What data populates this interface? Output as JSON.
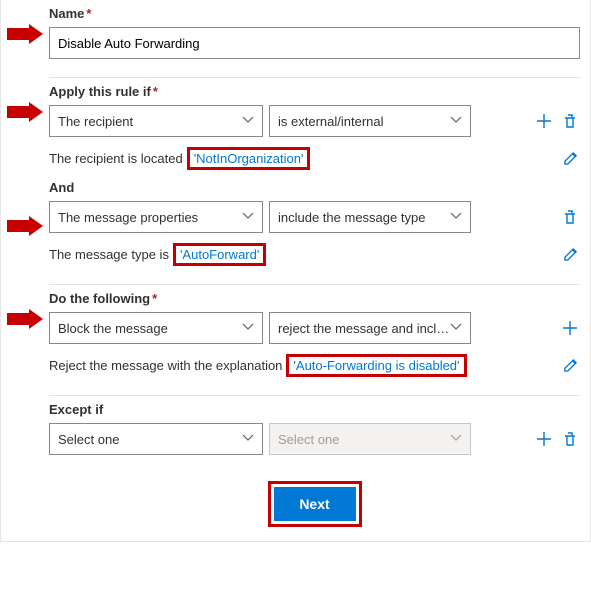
{
  "name": {
    "label": "Name",
    "value": "Disable Auto Forwarding"
  },
  "condition1": {
    "label": "Apply this rule if",
    "select1": "The recipient",
    "select2": "is external/internal",
    "desc_prefix": "The recipient is located",
    "highlight": "'NotInOrganization'"
  },
  "and_label": "And",
  "condition2": {
    "select1": "The message properties",
    "select2": "include the message type",
    "desc_prefix": "The message type is",
    "highlight": "'AutoForward'"
  },
  "action": {
    "label": "Do the following",
    "select1": "Block the message",
    "select2": "reject the message and incl…",
    "desc_prefix": "Reject the message with the explanation",
    "highlight": "'Auto-Forwarding is disabled'"
  },
  "except": {
    "label": "Except if",
    "select1": "Select one",
    "select2": "Select one"
  },
  "next_label": "Next"
}
